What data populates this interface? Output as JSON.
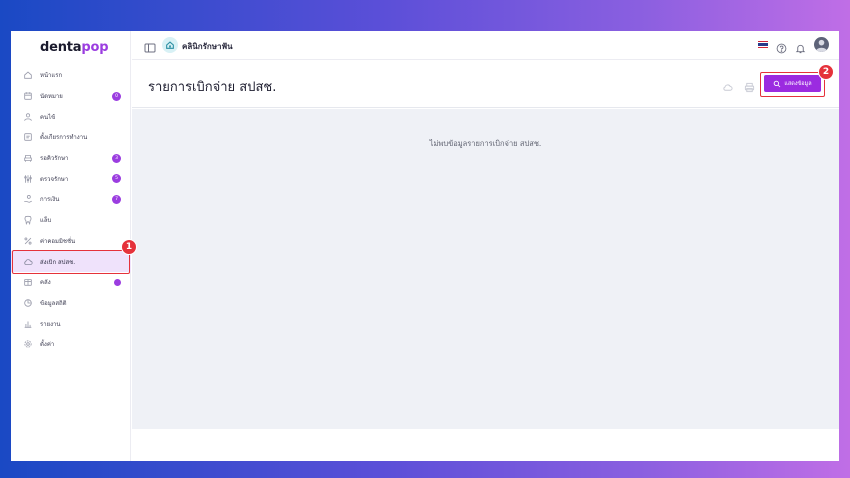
{
  "sidebar": {
    "logo_main": "denta",
    "logo_accent": "pop",
    "items": [
      {
        "label": "หน้าแรก",
        "icon": "home-icon"
      },
      {
        "label": "นัดหมาย",
        "icon": "calendar-icon",
        "badge": "0"
      },
      {
        "label": "คนไข้",
        "icon": "user-icon"
      },
      {
        "label": "ตั้งเกียรการทำงาน",
        "icon": "id-card-icon"
      },
      {
        "label": "รอคิวรักษา",
        "icon": "armchair-icon",
        "badge": "3"
      },
      {
        "label": "ตรวจรักษา",
        "icon": "tools-icon",
        "badge": "5"
      },
      {
        "label": "การเงิน",
        "icon": "hand-coin-icon",
        "badge": "7"
      },
      {
        "label": "แล็บ",
        "icon": "tooth-icon"
      },
      {
        "label": "ค่าคอมมิชชั่น",
        "icon": "percent-icon"
      },
      {
        "label": "ส่งเบิก สปสช.",
        "icon": "cloud-icon",
        "active": true
      },
      {
        "label": "คลัง",
        "icon": "box-icon",
        "dot": true
      },
      {
        "label": "ข้อมูลสถิติ",
        "icon": "chart-circle-icon"
      },
      {
        "label": "รายงาน",
        "icon": "bar-chart-icon"
      },
      {
        "label": "ตั้งค่า",
        "icon": "gear-icon"
      }
    ]
  },
  "topbar": {
    "clinic_name": "คลินิกรักษาฟัน"
  },
  "page": {
    "title": "รายการเบิกจ่าย สปสช.",
    "show_button_label": "แสดงข้อมูล",
    "empty_message": "ไม่พบข้อมูลรายการเบิกจ่าย สปสช."
  },
  "annotations": {
    "step1": "1",
    "step2": "2"
  },
  "colors": {
    "accent": "#9b3de0",
    "button": "#9b2be0",
    "highlight": "#e5323b",
    "active_bg": "#efe2fb"
  }
}
